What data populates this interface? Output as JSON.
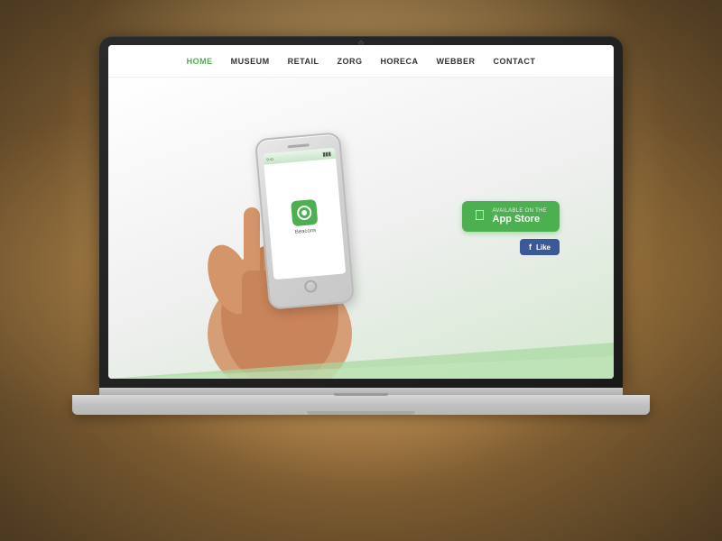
{
  "background": {
    "colors": {
      "primary": "#c8a96e",
      "dark": "#4a3820"
    }
  },
  "nav": {
    "items": [
      {
        "label": "HOME",
        "active": true
      },
      {
        "label": "MUSEUM",
        "active": false
      },
      {
        "label": "RETAIL",
        "active": false
      },
      {
        "label": "ZORG",
        "active": false
      },
      {
        "label": "HORECA",
        "active": false
      },
      {
        "label": "WEBBER",
        "active": false
      },
      {
        "label": "CONTACT",
        "active": false
      }
    ]
  },
  "hero": {
    "app_label": "Beacons",
    "appstore_button": {
      "small_text": "Available on the",
      "large_text": "App Store"
    },
    "facebook_button": {
      "label": "Like"
    }
  }
}
